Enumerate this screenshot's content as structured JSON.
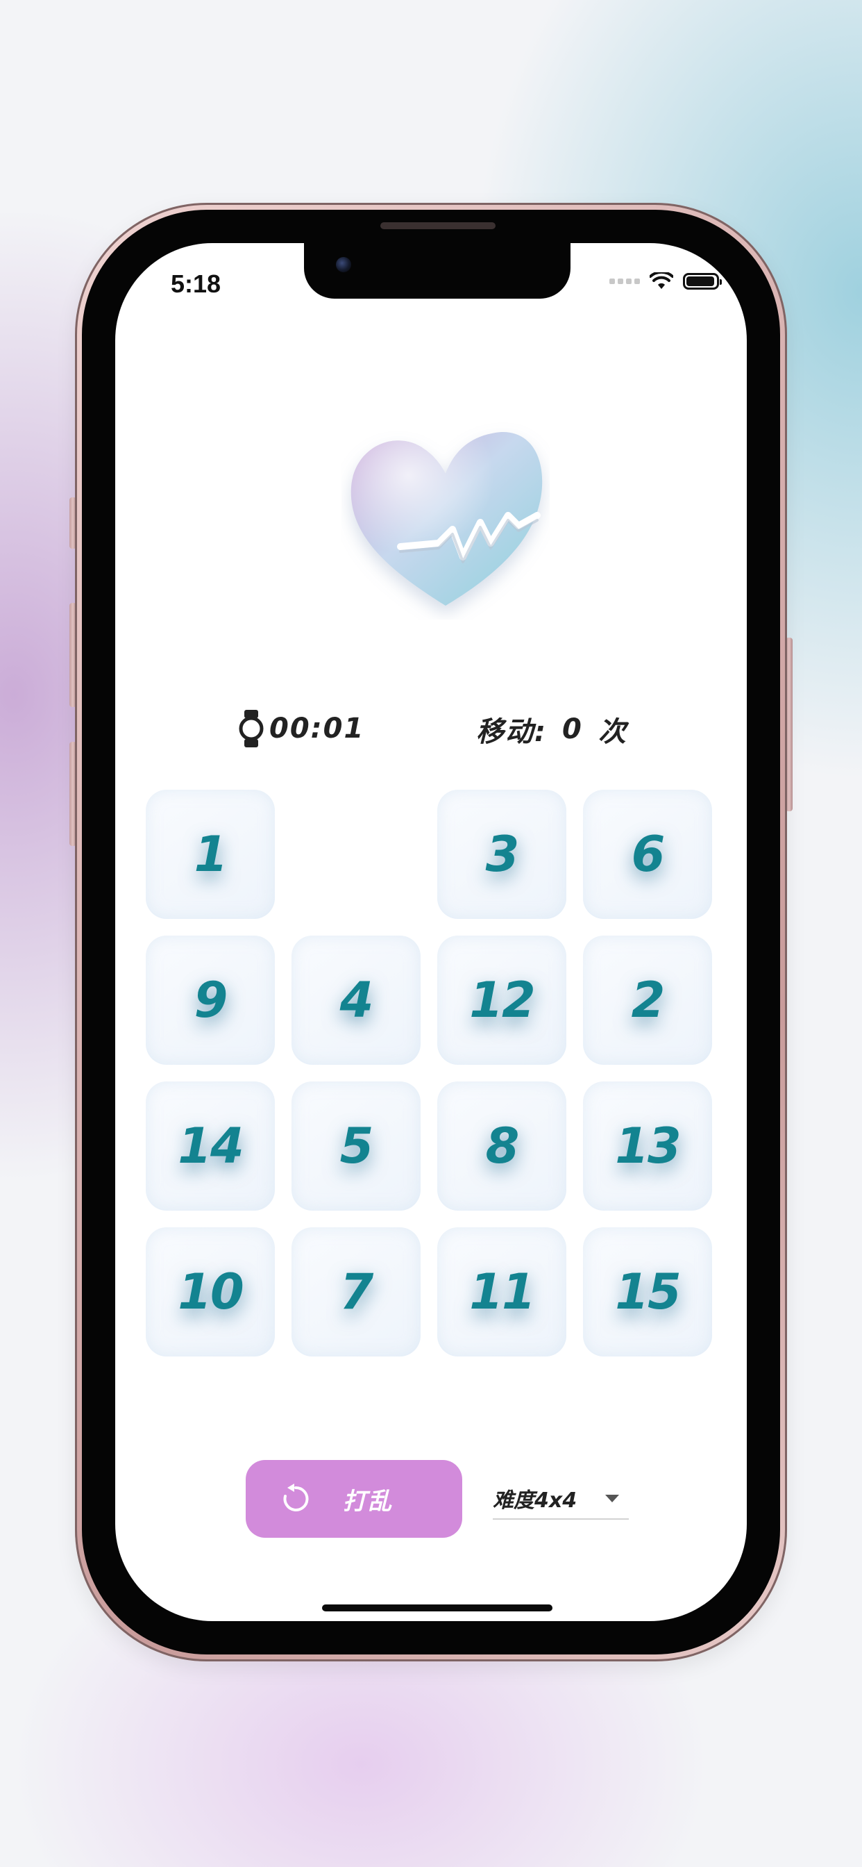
{
  "status_bar": {
    "time": "5:18",
    "battery_level": 0.95
  },
  "timer": {
    "icon": "watch-icon",
    "value": "00:01"
  },
  "moves": {
    "label": "移动:",
    "count": "0",
    "unit": "次"
  },
  "board": {
    "size": "4x4",
    "tiles": [
      "1",
      "",
      "3",
      "6",
      "9",
      "4",
      "12",
      "2",
      "14",
      "5",
      "8",
      "13",
      "10",
      "7",
      "11",
      "15"
    ]
  },
  "controls": {
    "shuffle_label": "打乱",
    "shuffle_icon": "refresh-icon",
    "difficulty_label": "难度4x4"
  },
  "colors": {
    "tile_number": "#138390",
    "shuffle_button": "#d28bdb",
    "tile_background": "#f2f7fc"
  }
}
